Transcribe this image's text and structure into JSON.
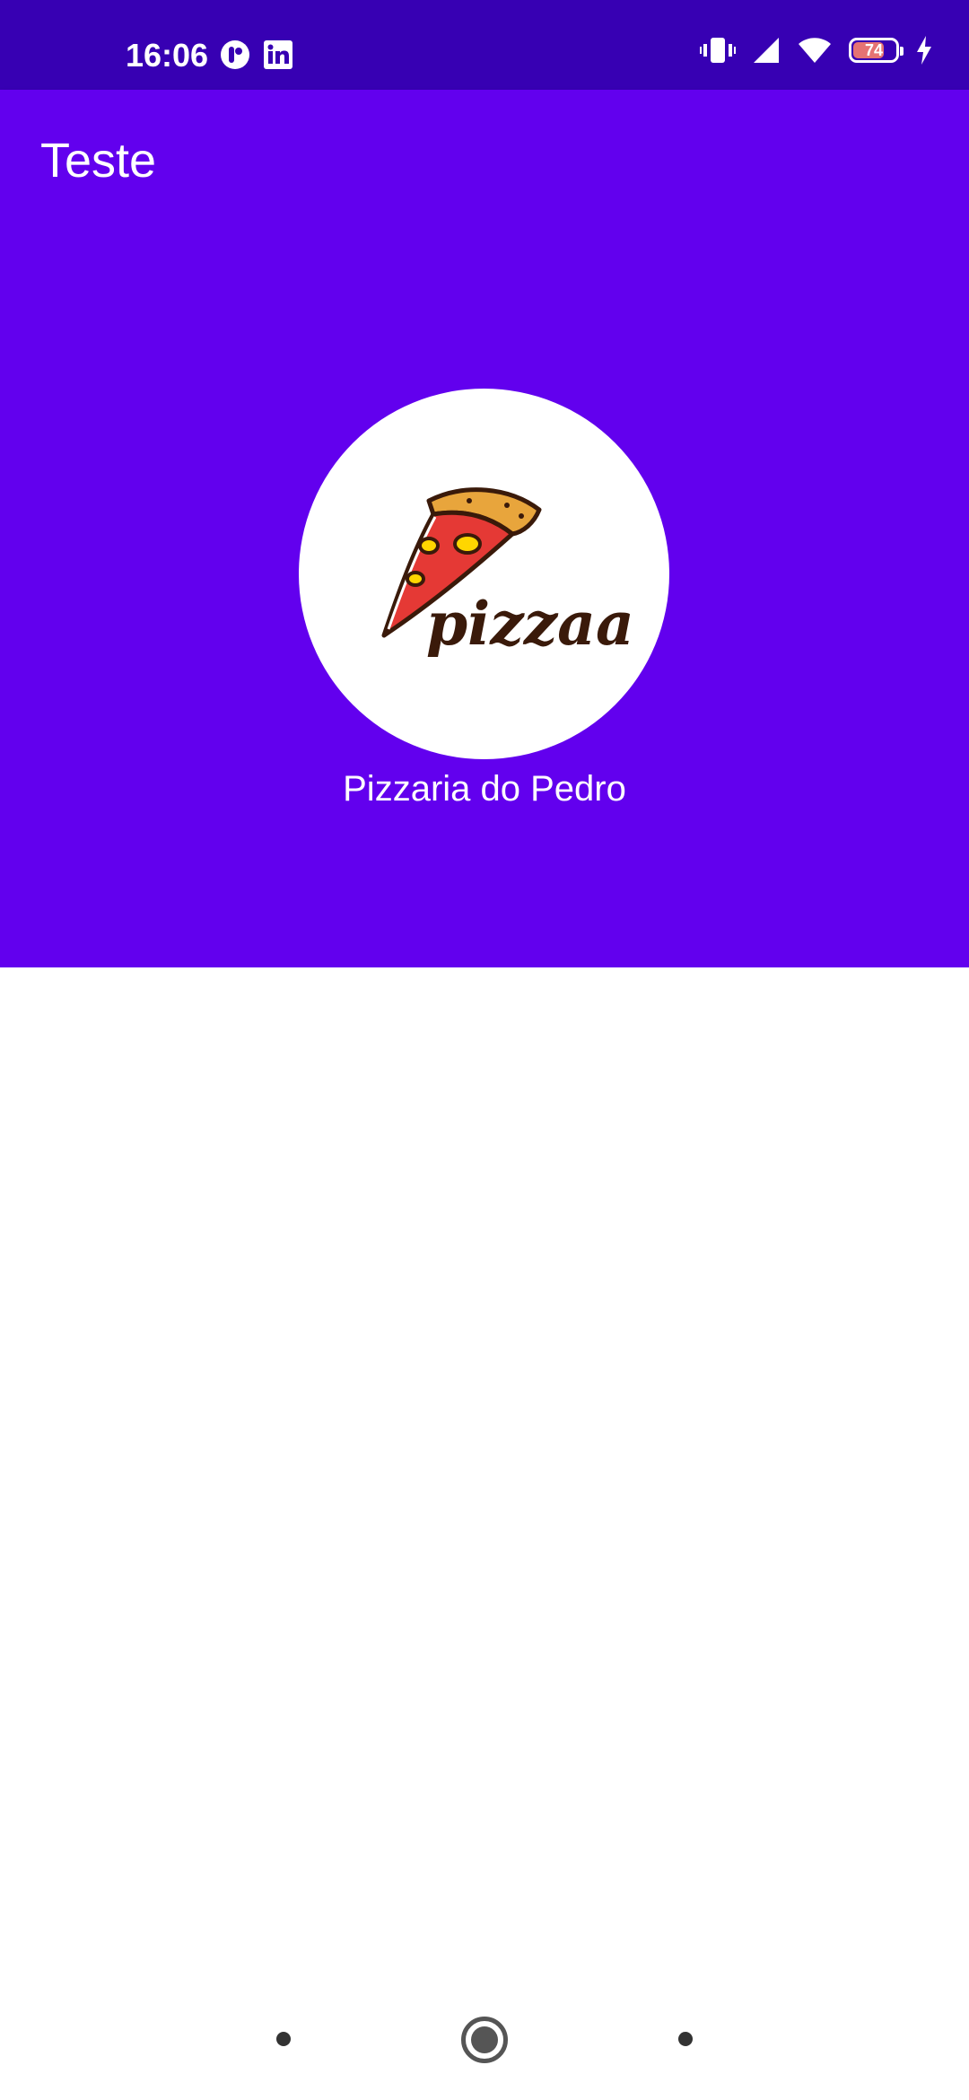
{
  "status_bar": {
    "time": "16:06",
    "battery_level": "74",
    "icons": [
      "notification-app-icon",
      "linkedin-icon",
      "vibrate-icon",
      "signal-icon",
      "wifi-icon",
      "battery-icon",
      "charging-icon"
    ]
  },
  "app_bar": {
    "title": "Teste"
  },
  "header": {
    "logo_text": "pizzaa",
    "store_name": "Pizzaria do Pedro"
  },
  "colors": {
    "status_bar": "#3700b3",
    "primary": "#6200ee",
    "background": "#ffffff"
  }
}
